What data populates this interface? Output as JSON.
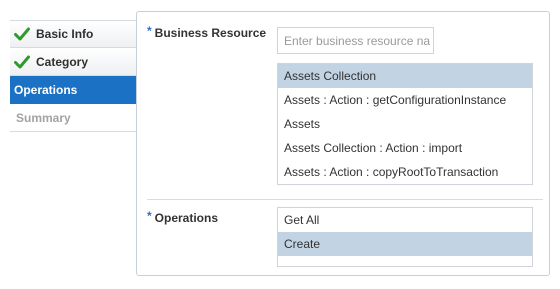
{
  "wizard": {
    "steps": [
      {
        "label": "Basic Info",
        "state": "done"
      },
      {
        "label": "Category",
        "state": "done"
      },
      {
        "label": "Operations",
        "state": "current"
      },
      {
        "label": "Summary",
        "state": "pending"
      }
    ]
  },
  "form": {
    "business_resource": {
      "required_mark": "*",
      "label": "Business Resource",
      "placeholder": "Enter business resource na",
      "options": [
        {
          "label": "Assets Collection",
          "selected": true
        },
        {
          "label": "Assets : Action : getConfigurationInstance",
          "selected": false
        },
        {
          "label": "Assets",
          "selected": false
        },
        {
          "label": "Assets Collection : Action : import",
          "selected": false
        },
        {
          "label": "Assets : Action : copyRootToTransaction",
          "selected": false
        }
      ]
    },
    "operations": {
      "required_mark": "*",
      "label": "Operations",
      "options": [
        {
          "label": "Get All",
          "selected": false
        },
        {
          "label": "Create",
          "selected": true
        }
      ]
    }
  },
  "colors": {
    "current_step": "#1b72c4",
    "selected_row": "#c2d3e3",
    "check_green": "#2e9a2e",
    "required_asterisk": "#2f6fcf"
  }
}
